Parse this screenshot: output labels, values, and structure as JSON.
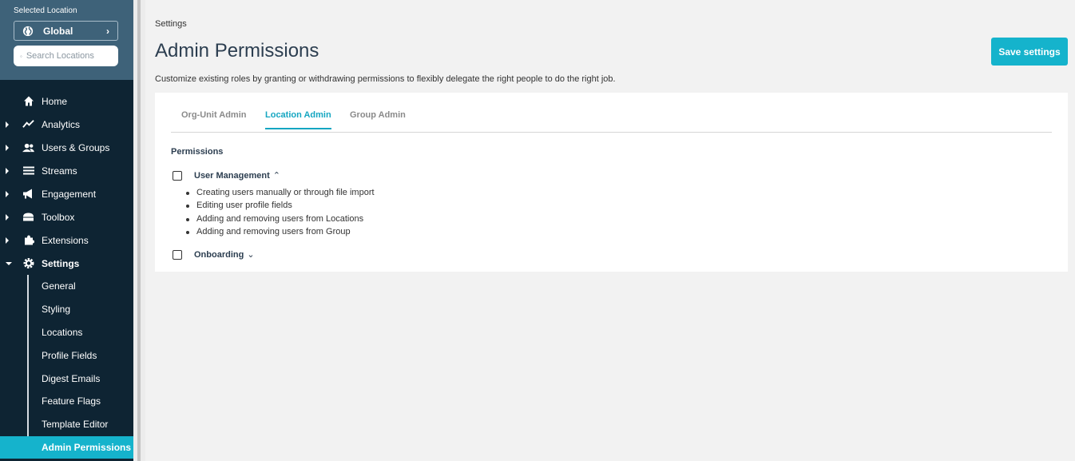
{
  "sidebar": {
    "selected_location_label": "Selected Location",
    "location_button": "Global",
    "search_placeholder": "Search Locations",
    "nav": [
      {
        "label": "Home",
        "icon": "home-icon"
      },
      {
        "label": "Analytics",
        "icon": "analytics-icon"
      },
      {
        "label": "Users & Groups",
        "icon": "users-icon"
      },
      {
        "label": "Streams",
        "icon": "streams-icon"
      },
      {
        "label": "Engagement",
        "icon": "megaphone-icon"
      },
      {
        "label": "Toolbox",
        "icon": "toolbox-icon"
      },
      {
        "label": "Extensions",
        "icon": "puzzle-icon"
      },
      {
        "label": "Settings",
        "icon": "gear-icon"
      }
    ],
    "settings_sub": [
      {
        "label": "General"
      },
      {
        "label": "Styling"
      },
      {
        "label": "Locations"
      },
      {
        "label": "Profile Fields"
      },
      {
        "label": "Digest Emails"
      },
      {
        "label": "Feature Flags"
      },
      {
        "label": "Template Editor"
      },
      {
        "label": "Admin Permissions"
      }
    ]
  },
  "main": {
    "breadcrumb": "Settings",
    "title": "Admin Permissions",
    "save_label": "Save settings",
    "description": "Customize existing roles by granting or withdrawing permissions to flexibly delegate the right people to do the right job.",
    "tabs": [
      {
        "label": "Org-Unit Admin",
        "active": false
      },
      {
        "label": "Location Admin",
        "active": true
      },
      {
        "label": "Group Admin",
        "active": false
      }
    ],
    "permissions_heading": "Permissions",
    "permissions": [
      {
        "label": "User Management",
        "expanded": true,
        "checked": false,
        "items": [
          "Creating users manually or through file import",
          "Editing user profile fields",
          "Adding and removing users from Locations",
          "Adding and removing users from Group"
        ]
      },
      {
        "label": "Onboarding",
        "expanded": false,
        "checked": false
      }
    ]
  },
  "colors": {
    "accent": "#15b3cc",
    "sidebar_bg": "#0e2433",
    "sidebar_top_bg": "#3e6279"
  }
}
